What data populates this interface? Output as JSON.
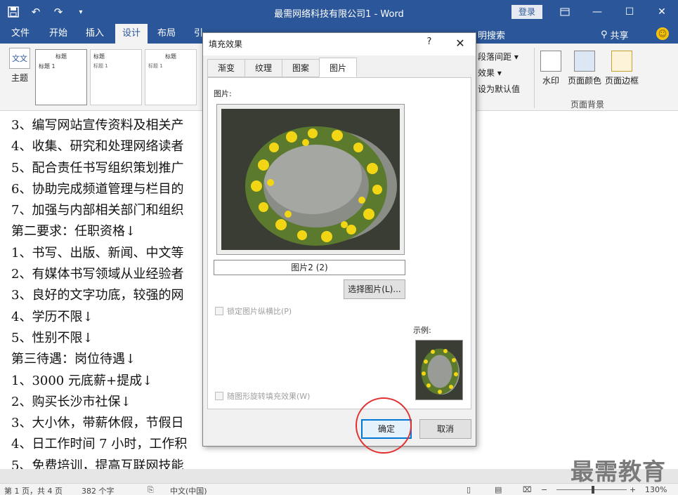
{
  "titlebar": {
    "title": "最需网络科技有限公司1 - Word",
    "login": "登录"
  },
  "tabs": [
    "文件",
    "开始",
    "插入",
    "设计",
    "布局",
    "引"
  ],
  "tell_me": "明搜索",
  "share": "共享",
  "ribbon": {
    "theme_label": "主题",
    "theme_icon_text": "文文",
    "style_thumbs": [
      {
        "head": "标题",
        "sub": "标题 1"
      },
      {
        "head": "标题",
        "sub": "标题 1"
      },
      {
        "head": "标题",
        "sub": "标题 1"
      }
    ],
    "menu_items": [
      "段落间距 ▾",
      "效果 ▾",
      "设为默认值"
    ],
    "watermark_btn": "水印",
    "page_color_btn": "页面颜色",
    "page_border_btn": "页面边框",
    "group_label": "页面背景"
  },
  "document": {
    "lines": [
      "3、编写网站宣传资料及相关产",
      "4、收集、研究和处理网络读者",
      "5、配合责任书写组织策划推广",
      "6、协助完成频道管理与栏目的",
      "7、加强与内部相关部门和组织",
      "第二要求：任职资格↓",
      "1、书写、出版、新闻、中文等",
      "2、有媒体书写领域从业经验者",
      "3、良好的文字功底，较强的网",
      "4、学历不限↓",
      "5、性别不限↓",
      "第三待遇：岗位待遇↓",
      "1、3000 元底薪+提成↓",
      "2、购买长沙市社保↓",
      "3、大小休，带薪休假，节假日",
      "4、日工作时间 7 小时，工作积",
      "5、免费培训，提高互联网技能"
    ]
  },
  "dialog": {
    "title": "填充效果",
    "help": "?",
    "close": "✕",
    "tabs": [
      "渐变",
      "纹理",
      "图案",
      "图片"
    ],
    "picture_label": "图片:",
    "picture_name": "图片2 (2)",
    "choose_button": "选择图片(L)...",
    "lock_ratio": "锁定图片纵横比(P)",
    "rotate_fill": "随图形旋转填充效果(W)",
    "sample_label": "示例:",
    "ok": "确定",
    "cancel": "取消"
  },
  "watermark": "最需教育",
  "statusbar": {
    "page": "第 1 页，共 4 页",
    "words": "382 个字",
    "language": "中文(中国)",
    "zoom": "130%",
    "zoom_minus": "−",
    "zoom_plus": "+"
  }
}
